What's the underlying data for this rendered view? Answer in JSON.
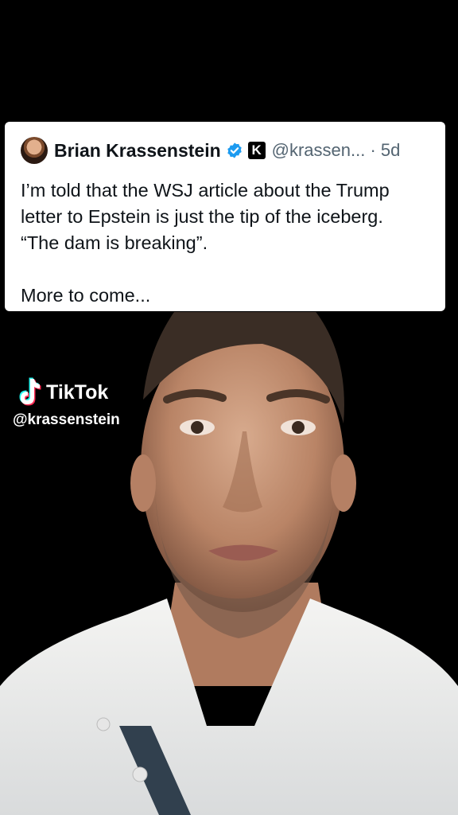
{
  "tweet": {
    "author": "Brian Krassenstein",
    "affiliation_badge": "K",
    "handle": "@krassen...",
    "separator": "·",
    "age": "5d",
    "lines": [
      "I’m told that the WSJ article about the Trump",
      "letter to Epstein is just the tip of the iceberg.",
      "“The dam is breaking”."
    ],
    "more": "More to come...",
    "verified_color": "#1d9bf0"
  },
  "watermark": {
    "brand": "TikTok",
    "handle": "@krassenstein",
    "logo_icon": "tiktok-note-icon"
  }
}
